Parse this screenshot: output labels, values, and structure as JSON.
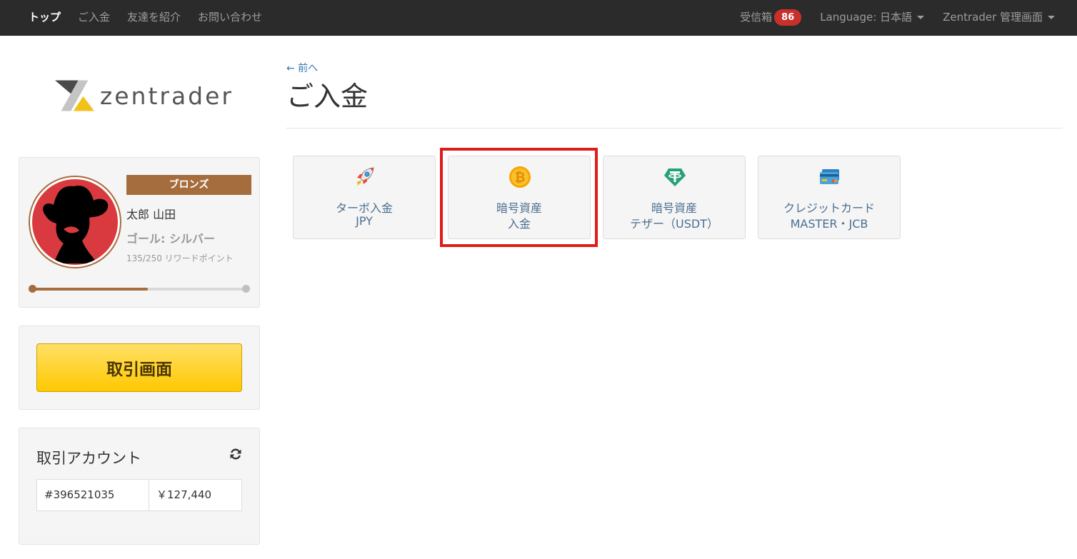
{
  "navbar": {
    "items": [
      {
        "label": "トップ",
        "active": true
      },
      {
        "label": "ご入金"
      },
      {
        "label": "友達を紹介"
      },
      {
        "label": "お問い合わせ"
      }
    ],
    "inbox_label": "受信箱",
    "inbox_count": "86",
    "language_label": "Language: 日本語",
    "admin_label": "Zentrader 管理画面"
  },
  "sidebar": {
    "logo_text": "zentrader",
    "profile": {
      "rank": "ブロンズ",
      "name": "太郎 山田",
      "goal": "ゴール: シルバー",
      "points": "135/250 リワードポイント",
      "progress_fraction": 0.54
    },
    "trade_button": "取引画面",
    "account": {
      "title": "取引アカウント",
      "number": "#396521035",
      "balance": "￥127,440"
    }
  },
  "main": {
    "back_link": "← 前へ",
    "title": "ご入金",
    "methods": [
      {
        "icon": "rocket-icon",
        "line1": "ターボ入金",
        "line2": "JPY"
      },
      {
        "icon": "bitcoin-icon",
        "line1": "暗号資産",
        "line2": "入金",
        "highlighted": true
      },
      {
        "icon": "tether-icon",
        "line1": "暗号資産",
        "line2": "テザー（USDT）"
      },
      {
        "icon": "credit-card-icon",
        "line1": "クレジットカード",
        "line2": "MASTER・JCB"
      }
    ]
  },
  "colors": {
    "navbar_bg": "#2b2b2b",
    "rank_bronze": "#a56d3d",
    "trade_button": "#ffc800",
    "badge_red": "#c9302c",
    "highlight_red": "#e01b1b",
    "link_blue": "#337ab7"
  }
}
